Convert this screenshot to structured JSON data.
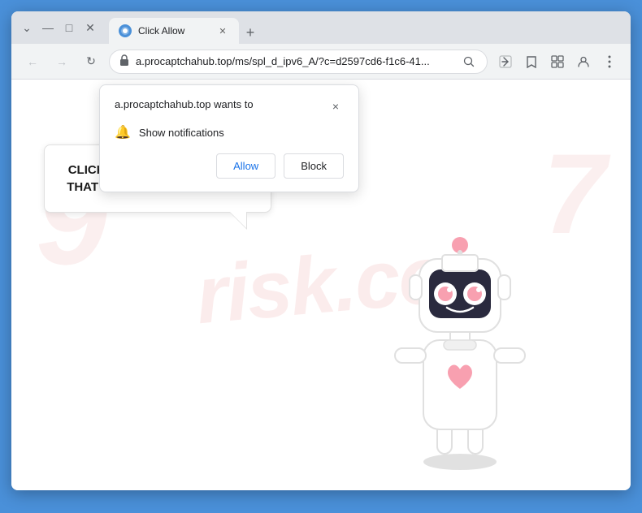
{
  "browser": {
    "tab": {
      "title": "Click Allow",
      "favicon": "C"
    },
    "new_tab_label": "+",
    "window_controls": {
      "minimize": "—",
      "maximize": "□",
      "close": "✕",
      "chevron": "⌄"
    },
    "address_bar": {
      "url": "a.procaptchahub.top/ms/spl_d_ipv6_A/?c=d2597cd6-f1c6-41...",
      "lock_icon": "🔒"
    },
    "nav": {
      "back": "←",
      "forward": "→",
      "reload": "↻"
    }
  },
  "notification_popup": {
    "site": "a.procaptchahub.top wants to",
    "permission": "Show notifications",
    "allow_label": "Allow",
    "block_label": "Block",
    "close_label": "×"
  },
  "speech_bubble": {
    "text": "CLICK «ALLOW» TO CONFIRM THAT YOU ARE NOT A ROBOT!"
  },
  "watermark": {
    "text": "risk.co"
  }
}
